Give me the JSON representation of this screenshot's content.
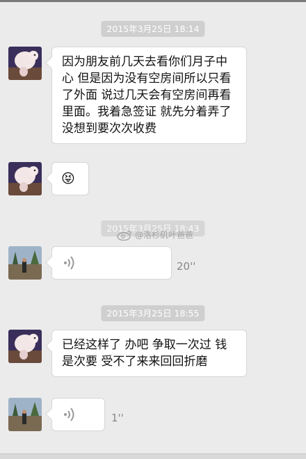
{
  "messages": [
    {
      "timestamp": "2015年3月25日 18:14"
    },
    {
      "text": "因为朋友前几天去看你们月子中心 但是因为没有空房间所以只看了外面 说过几天会有空房间再看里面。我着急签证 就先分着弄了 没想到要次次收费"
    },
    {
      "emoji": "😝"
    },
    {
      "timestamp": "2015年3月25日 18:43"
    },
    {
      "voice_duration": "20''"
    },
    {
      "timestamp": "2015年3月25日 18:55"
    },
    {
      "text": "已经这样了 办吧 争取一次过 钱是次要 受不了来来回回折磨"
    },
    {
      "voice_duration": "1''"
    }
  ],
  "watermark": {
    "text": "@洛杉矶叶爸爸"
  },
  "colors": {
    "background": "#ebebeb",
    "bubble": "#ffffff",
    "timestamp_bg": "#cfcfcf"
  }
}
